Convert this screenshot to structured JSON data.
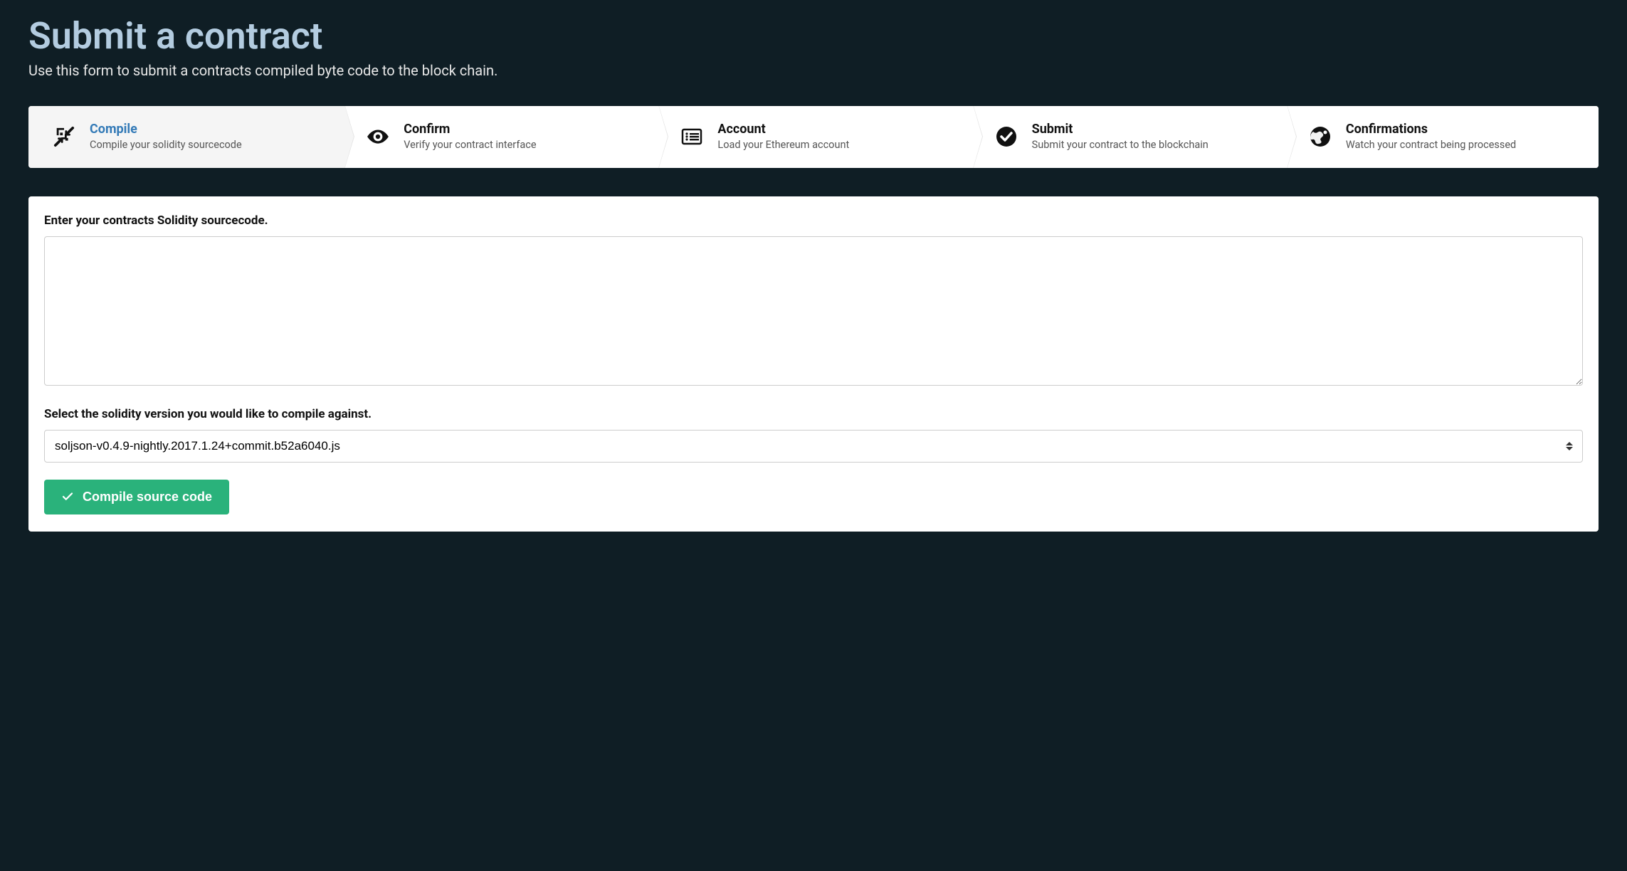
{
  "header": {
    "title": "Submit a contract",
    "subtitle": "Use this form to submit a contracts compiled byte code to the block chain."
  },
  "wizard": {
    "steps": [
      {
        "title": "Compile",
        "desc": "Compile your solidity sourcecode",
        "icon": "compress-icon",
        "active": true
      },
      {
        "title": "Confirm",
        "desc": "Verify your contract interface",
        "icon": "eye-icon",
        "active": false
      },
      {
        "title": "Account",
        "desc": "Load your Ethereum account",
        "icon": "list-icon",
        "active": false
      },
      {
        "title": "Submit",
        "desc": "Submit your contract to the blockchain",
        "icon": "check-circle-icon",
        "active": false
      },
      {
        "title": "Confirmations",
        "desc": "Watch your contract being processed",
        "icon": "globe-icon",
        "active": false
      }
    ]
  },
  "form": {
    "sourcecode_label": "Enter your contracts Solidity sourcecode.",
    "sourcecode_value": "",
    "version_label": "Select the solidity version you would like to compile against.",
    "version_selected": "soljson-v0.4.9-nightly.2017.1.24+commit.b52a6040.js",
    "compile_button": "Compile source code"
  }
}
